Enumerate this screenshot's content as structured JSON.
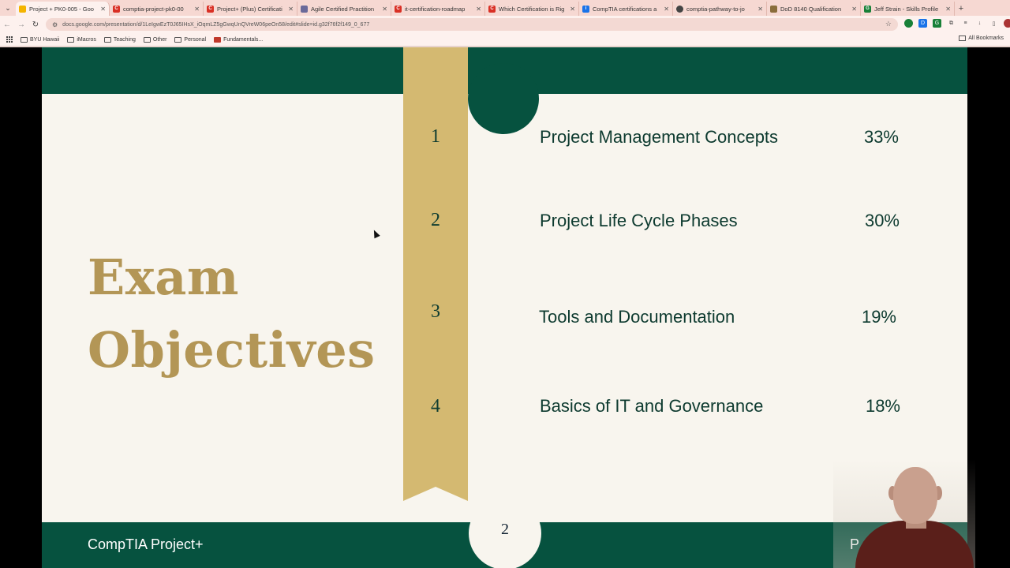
{
  "browser": {
    "tabs": [
      {
        "title": "Project + PK0-005 - Goo",
        "favicon_color": "#f4b400",
        "active": true
      },
      {
        "title": "comptia-project-pk0-00",
        "favicon_color": "#d93025",
        "active": false
      },
      {
        "title": "Project+ (Plus) Certificati",
        "favicon_color": "#d93025",
        "active": false
      },
      {
        "title": "Agile Certified Practition",
        "favicon_color": "#6a6a9a",
        "active": false
      },
      {
        "title": "it-certification-roadmap",
        "favicon_color": "#d93025",
        "active": false
      },
      {
        "title": "Which Certification is Rig",
        "favicon_color": "#d93025",
        "active": false
      },
      {
        "title": "CompTIA certifications a",
        "favicon_color": "#1a73e8",
        "active": false
      },
      {
        "title": "comptia-pathway-to-jo",
        "favicon_color": "#444444",
        "active": false
      },
      {
        "title": "DoD 8140 Qualification",
        "favicon_color": "#8a6d3b",
        "active": false
      },
      {
        "title": "Jeff Strain - Skills Profile",
        "favicon_color": "#188038",
        "active": false
      }
    ],
    "url": "docs.google.com/presentation/d/1LeIgwEzT0J65IHsX_iOqmLZ5gGwqUnQVreW06peOn58/edit#slide=id.g32f76f2f149_0_677",
    "bookmarks": [
      {
        "label": "BYU Hawaii"
      },
      {
        "label": "iMacros"
      },
      {
        "label": "Teaching"
      },
      {
        "label": "Other"
      },
      {
        "label": "Personal"
      },
      {
        "label": "Fundamentals..."
      }
    ],
    "all_bookmarks_label": "All Bookmarks"
  },
  "slide": {
    "title_line1": "Exam",
    "title_line2": "Objectives",
    "objectives": [
      {
        "number": "1",
        "label": "Project Management Concepts",
        "percent": "33%"
      },
      {
        "number": "2",
        "label": "Project Life Cycle Phases",
        "percent": "30%"
      },
      {
        "number": "3",
        "label": "Tools and Documentation",
        "percent": "19%"
      },
      {
        "number": "4",
        "label": "Basics of IT and Governance",
        "percent": "18%"
      }
    ],
    "page_number": "2",
    "footer_left": "CompTIA Project+",
    "footer_right": "P",
    "colors": {
      "dark_green": "#06523f",
      "gold": "#d4b971",
      "title_gold": "#b39656",
      "background": "#f8f5ee"
    }
  }
}
